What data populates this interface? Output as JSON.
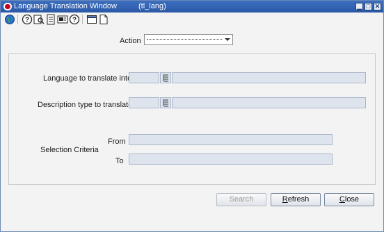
{
  "window": {
    "title": "Language Translation Window",
    "code": "(tl_lang)",
    "controls": {
      "minimize": "▁",
      "maximize": "□",
      "close": "✕"
    }
  },
  "toolbar": {
    "buttons": [
      {
        "name": "globe-icon"
      },
      {
        "name": "help-icon"
      },
      {
        "name": "search-icon"
      },
      {
        "name": "print-icon"
      },
      {
        "name": "notes-icon"
      },
      {
        "name": "info-icon"
      },
      {
        "name": "window-icon"
      },
      {
        "name": "new-document-icon"
      }
    ]
  },
  "action": {
    "label": "Action",
    "value": ""
  },
  "form": {
    "language_label": "Language to translate into",
    "language_code": "",
    "language_desc": "",
    "description_type_label": "Description type to translate",
    "description_type_code": "",
    "description_type_desc": "",
    "selection_criteria_label": "Selection Criteria",
    "from_label": "From",
    "from_value": "",
    "to_label": "To",
    "to_value": ""
  },
  "buttons": {
    "search": {
      "prefix": "",
      "mnemonic": "",
      "label": "Search",
      "enabled": false
    },
    "refresh": {
      "prefix": "",
      "mnemonic": "R",
      "rest": "efresh"
    },
    "close": {
      "prefix": "",
      "mnemonic": "C",
      "rest": "lose"
    }
  },
  "colors": {
    "titlebar": "#2a58a6",
    "field_bg": "#dde4ee",
    "background": "#f3f3f3"
  }
}
